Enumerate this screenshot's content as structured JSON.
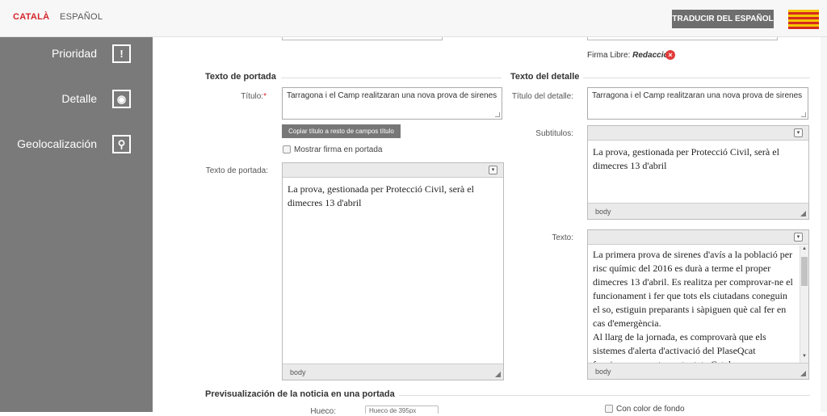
{
  "top": {
    "lang_active": "CATALÀ",
    "lang_other": "ESPAÑOL",
    "translate_button": "TRADUCIR DEL ESPAÑOL"
  },
  "sidebar": {
    "items": [
      {
        "label": "Prioridad",
        "icon": "exclamation-icon",
        "glyph": "!"
      },
      {
        "label": "Detalle",
        "icon": "eye-icon",
        "glyph": "◉"
      },
      {
        "label": "Geolocalización",
        "icon": "map-pin-icon",
        "glyph": "⚲"
      }
    ]
  },
  "firma": {
    "label": "Firma Libre:",
    "value": "Redacció"
  },
  "portada": {
    "section_title": "Texto de portada",
    "titulo_label": "Título:",
    "required_mark": "*",
    "titulo_value": "Tarragona i el Camp realitzaran una nova prova de sirenes",
    "copy_button": "Copiar título a resto de campos título",
    "mostrar_firma": "Mostrar firma en portada",
    "texto_label": "Texto de portada:",
    "texto_value": "La prova, gestionada per Protecció Civil, serà el dimecres 13 d'abril",
    "footer": "body"
  },
  "detalle": {
    "section_title": "Texto del detalle",
    "titulo_label": "Título del detalle:",
    "titulo_value": "Tarragona i el Camp realitzaran una nova prova de sirenes",
    "subtitulos_label": "Subtitulos:",
    "subtitulos_value": "La prova, gestionada per Protecció Civil, serà el dimecres 13 d'abril",
    "subtitulos_footer": "body",
    "texto_label": "Texto:",
    "texto_p1": "La primera prova de sirenes d'avís a la població per risc químic del 2016 es durà a terme el proper dimecres 13 d'abril. Es realitza per comprovar-ne el funcionament i fer que tots els ciutadans coneguin el so, estiguin preparants i sàpiguen què cal fer en cas d'emergència.",
    "texto_p2": "Al llarg de la jornada, es comprovarà que els sistemes d'alerta d'activació del PlaseQcat funcionen correctament a tota Catalunya.",
    "texto_footer": "body"
  },
  "preview": {
    "section_title": "Previsualización de la noticia en una portada",
    "hueco_label": "Hueco:",
    "hueco_value": "Hueco de 395px",
    "color_fondo": "Con color de fondo"
  },
  "colors": {
    "accent": "#d4262b",
    "sidebar": "#7a7a7a",
    "button": "#6e6e6e"
  }
}
